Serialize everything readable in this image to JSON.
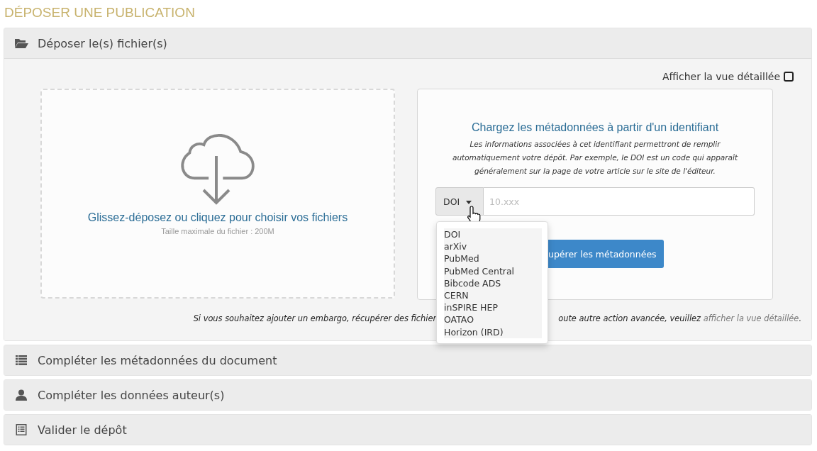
{
  "page_title": "DÉPOSER UNE PUBLICATION",
  "sections": [
    {
      "kind": "folder",
      "label": "Déposer le(s) fichier(s)",
      "expanded": true
    },
    {
      "kind": "list",
      "label": "Compléter les métadonnées du document",
      "expanded": false
    },
    {
      "kind": "user",
      "label": "Compléter les données auteur(s)",
      "expanded": false
    },
    {
      "kind": "form",
      "label": "Valider le dépôt",
      "expanded": false
    }
  ],
  "detailed_view": {
    "label": "Afficher la vue détaillée",
    "checked": false
  },
  "dropzone": {
    "title": "Glissez-déposez ou cliquez pour choisir vos fichiers",
    "max_size": "Taille maximale du fichier : 200M"
  },
  "identifier_card": {
    "title": "Chargez les métadonnées à partir d'un identifiant",
    "description": "Les informations associées à cet identifiant permettront de remplir automatiquement votre dépôt. Par exemple, le DOI est un code qui apparaît généralement sur la page de votre article sur le site de l'éditeur.",
    "type_button": "DOI",
    "placeholder": "10.xxx",
    "fetch_button": "upérer les métadonnées",
    "dropdown": [
      {
        "label": "DOI"
      },
      {
        "label": "arXiv"
      },
      {
        "label": "PubMed"
      },
      {
        "label": "PubMed Central"
      },
      {
        "label": "Bibcode ADS"
      },
      {
        "label": "CERN"
      },
      {
        "label": "inSPIRE HEP"
      },
      {
        "label": "OATAO"
      },
      {
        "label": "Horizon (IRD)"
      }
    ]
  },
  "hint": {
    "before": "Si vous souhaitez ajouter un embargo, récupérer des fichier",
    "after": "oute autre action avancée, veuillez ",
    "link": "afficher la vue détaillée",
    "end": "."
  }
}
